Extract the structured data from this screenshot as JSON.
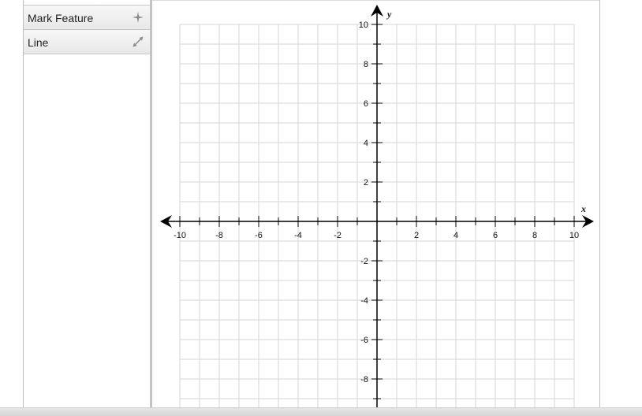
{
  "tools": [
    {
      "label": "Mark Feature",
      "icon": "sparkle-icon"
    },
    {
      "label": "Line",
      "icon": "line-tool-icon"
    }
  ],
  "graph": {
    "x_axis_name": "x",
    "y_axis_name": "y",
    "x_range": [
      -10,
      10
    ],
    "y_range": [
      -10,
      10
    ],
    "grid_step": 1,
    "label_step": 2,
    "x_tick_labels": [
      "-10",
      "-8",
      "-6",
      "-4",
      "-2",
      "2",
      "4",
      "6",
      "8",
      "10"
    ],
    "y_tick_labels": [
      "10",
      "8",
      "6",
      "4",
      "2",
      "-2",
      "-4",
      "-6",
      "-8"
    ],
    "grid_color": "#d6d6d6",
    "axis_color": "#000000"
  }
}
